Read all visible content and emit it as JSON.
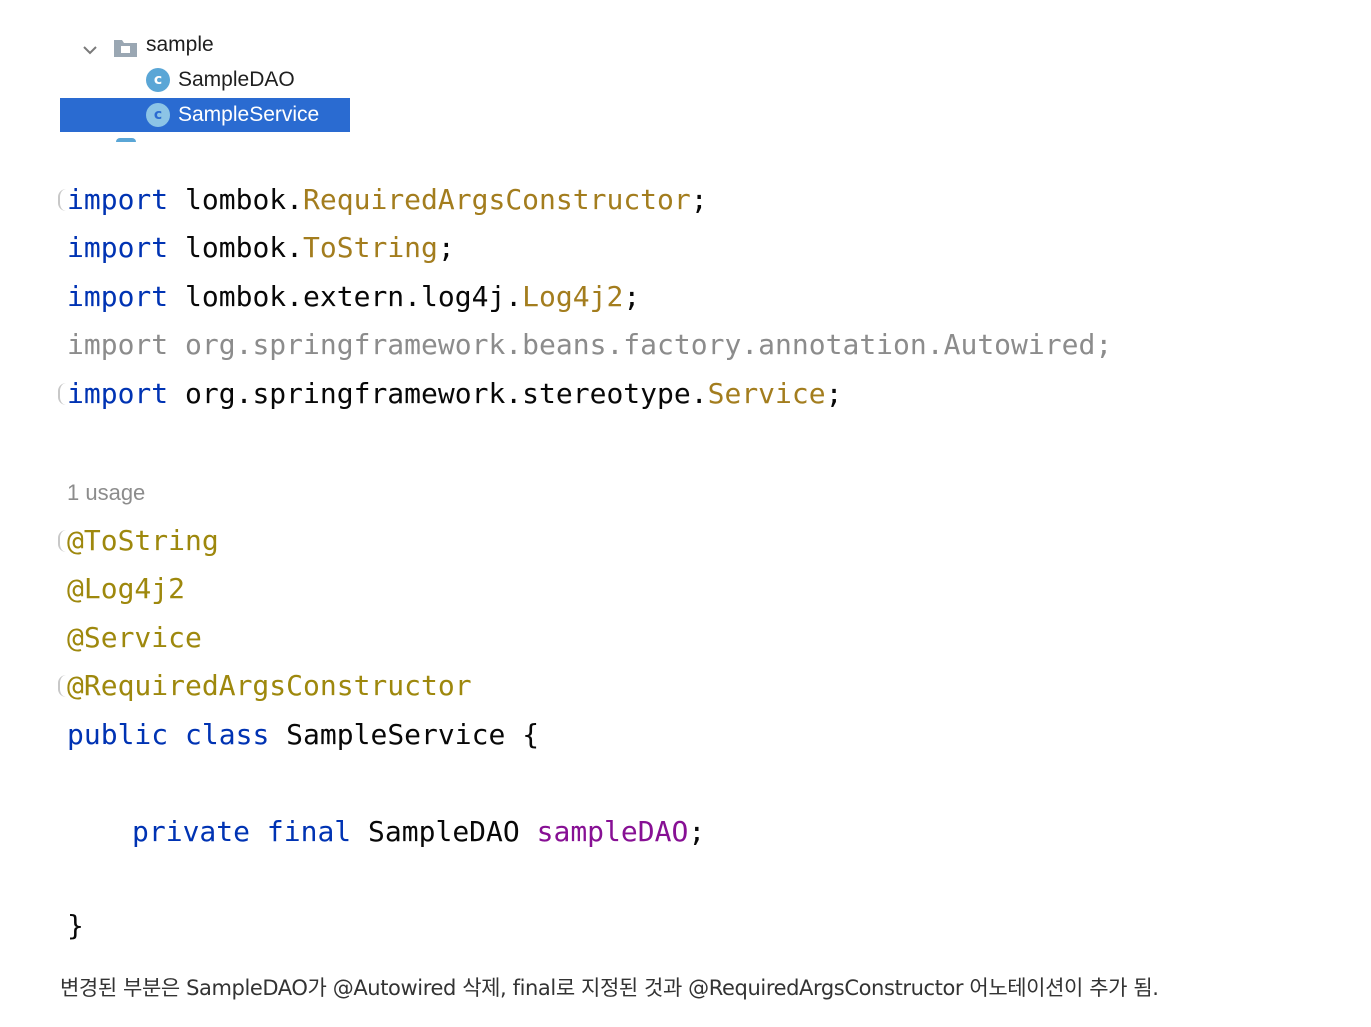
{
  "project_tree": {
    "folder_label": "sample",
    "items": [
      {
        "label": "SampleDAO",
        "icon": "class-icon",
        "icon_letter": "c",
        "selected": false
      },
      {
        "label": "SampleService",
        "icon": "class-icon",
        "icon_letter": "c",
        "selected": true
      }
    ],
    "selection_color": "#2a6bd1"
  },
  "editor": {
    "imports": [
      {
        "keyword": "import",
        "package": "lombok.",
        "name": "RequiredArgsConstructor",
        "end": ";"
      },
      {
        "keyword": "import",
        "package": "lombok.",
        "name": "ToString",
        "end": ";"
      },
      {
        "keyword": "import",
        "package": "lombok.extern.log4j.",
        "name": "Log4j2",
        "end": ";"
      },
      {
        "keyword": "import",
        "package": "org.springframework.beans.factory.annotation.",
        "name": "Autowired",
        "end": ";",
        "unused": true
      },
      {
        "keyword": "import",
        "package": "org.springframework.stereotype.",
        "name": "Service",
        "end": ";"
      }
    ],
    "usage_hint": "1 usage",
    "annotations": [
      "@ToString",
      "@Log4j2",
      "@Service",
      "@RequiredArgsConstructor"
    ],
    "class_declaration": {
      "modifier": "public",
      "keyword": "class",
      "name": "SampleService",
      "open_brace": "{"
    },
    "field": {
      "modifier": "private",
      "final": "final",
      "type": "SampleDAO",
      "name": "sampleDAO",
      "end": ";"
    },
    "close_brace": "}"
  },
  "caption": "변경된 부분은 SampleDAO가 @Autowired 삭제, final로 지정된 것과 @RequiredArgsConstructor 어노테이션이 추가 됨.",
  "colors": {
    "keyword": "#0033b3",
    "class_reference": "#a37d1e",
    "annotation": "#9e880d",
    "field": "#871094",
    "unused": "#8c8c8c"
  }
}
